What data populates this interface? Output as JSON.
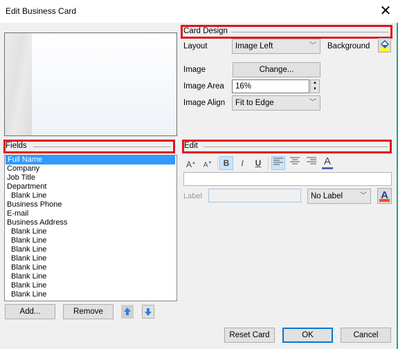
{
  "window": {
    "title": "Edit Business Card",
    "close_label": "✕"
  },
  "card_design": {
    "heading": "Card Design",
    "layout_label": "Layout",
    "layout_value": "Image Left",
    "background_label": "Background",
    "background_color": "#ffff00",
    "image_label": "Image",
    "change_button": "Change...",
    "image_area_label": "Image Area",
    "image_area_value": "16%",
    "image_align_label": "Image Align",
    "image_align_value": "Fit to Edge"
  },
  "fields": {
    "heading": "Fields",
    "items": [
      {
        "label": "Full Name",
        "indent": false,
        "selected": true
      },
      {
        "label": "Company",
        "indent": false
      },
      {
        "label": "Job Title",
        "indent": false
      },
      {
        "label": "Department",
        "indent": false
      },
      {
        "label": "Blank Line",
        "indent": true
      },
      {
        "label": "Business Phone",
        "indent": false
      },
      {
        "label": "E-mail",
        "indent": false
      },
      {
        "label": "Business Address",
        "indent": false
      },
      {
        "label": "Blank Line",
        "indent": true
      },
      {
        "label": "Blank Line",
        "indent": true
      },
      {
        "label": "Blank Line",
        "indent": true
      },
      {
        "label": "Blank Line",
        "indent": true
      },
      {
        "label": "Blank Line",
        "indent": true
      },
      {
        "label": "Blank Line",
        "indent": true
      },
      {
        "label": "Blank Line",
        "indent": true
      },
      {
        "label": "Blank Line",
        "indent": true
      }
    ],
    "add_button": "Add...",
    "remove_button": "Remove"
  },
  "edit": {
    "heading": "Edit",
    "toolbar": {
      "grow_font": "A",
      "shrink_font": "A",
      "bold": "B",
      "italic": "I",
      "underline": "U",
      "font_color": "A",
      "font_color_swatch": "#3f6fa8"
    },
    "text_value": "",
    "label_caption": "Label",
    "label_value": "",
    "label_position": "No Label",
    "label_color_swatch": "#ff4d00"
  },
  "footer": {
    "reset_button": "Reset Card",
    "ok_button": "OK",
    "cancel_button": "Cancel"
  },
  "accent": {
    "highlight_box": "#e3121c",
    "selection": "#3399ff",
    "focus": "#0078d7"
  }
}
